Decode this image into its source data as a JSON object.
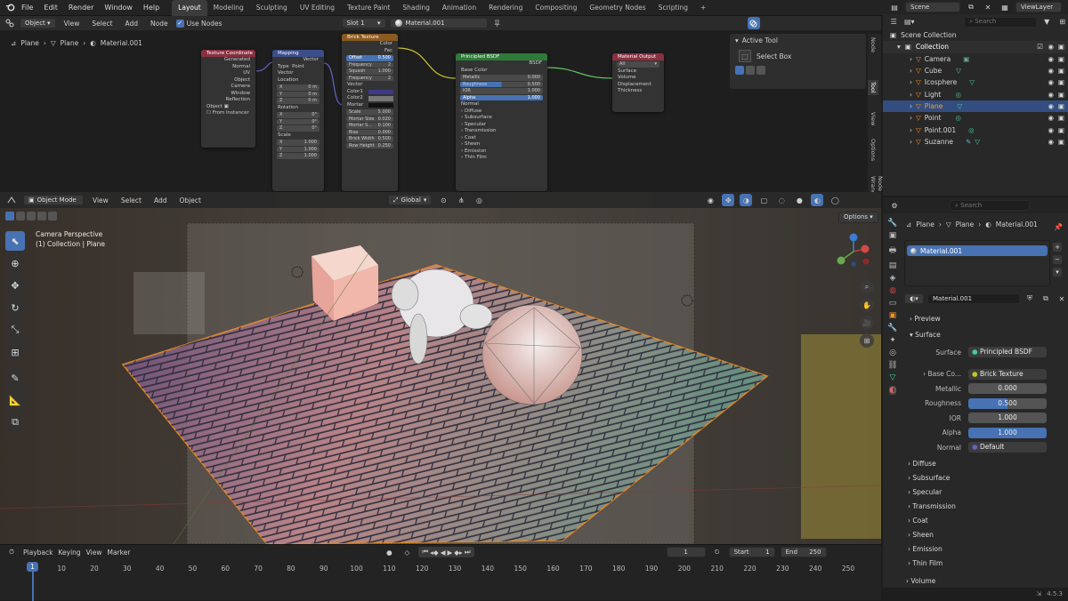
{
  "topbar": {
    "menus": [
      "File",
      "Edit",
      "Render",
      "Window",
      "Help"
    ],
    "workspaces": [
      "Layout",
      "Modeling",
      "Sculpting",
      "UV Editing",
      "Texture Paint",
      "Shading",
      "Animation",
      "Rendering",
      "Compositing",
      "Geometry Nodes",
      "Scripting"
    ],
    "active_workspace": "Layout",
    "scene": "Scene",
    "view_layer": "ViewLayer"
  },
  "node_editor": {
    "mode": "Object",
    "menus": [
      "View",
      "Select",
      "Add",
      "Node"
    ],
    "use_nodes_label": "Use Nodes",
    "slot": "Slot 1",
    "material": "Material.001",
    "breadcrumb": [
      "Plane",
      "Plane",
      "Material.001"
    ],
    "side_tabs": [
      "Node",
      "Tool",
      "View",
      "Options",
      "Node Wrangler"
    ],
    "active_tool_title": "Active Tool",
    "active_tool_item": "Select Box",
    "nodes": {
      "texcoord": {
        "title": "Texture Coordinate",
        "outputs": [
          "Generated",
          "Normal",
          "UV",
          "Object",
          "Camera",
          "Window",
          "Reflection"
        ],
        "object_label": "Object",
        "from_instancer": "From Instancer"
      },
      "mapping": {
        "title": "Mapping",
        "out": "Vector",
        "type_label": "Type",
        "type_val": "Point",
        "rows": [
          "Vector",
          "Location",
          "0 m",
          "0 m",
          "0 m",
          "Rotation",
          "0°",
          "0°",
          "0°",
          "Scale",
          "1.000",
          "1.000",
          "1.000"
        ],
        "labels": [
          "X",
          "Y",
          "Z",
          "X",
          "Y",
          "Z",
          "X",
          "Y",
          "Z"
        ]
      },
      "brick": {
        "title": "Brick Texture",
        "outputs": [
          "Color",
          "Fac"
        ],
        "offset_label": "Offset",
        "offset_val": "0.500",
        "frequency_label": "Frequency",
        "frequency_val": "2",
        "squash_label": "Squash",
        "squash_val": "1.000",
        "frequency2_label": "Frequency",
        "frequency2_val": "2",
        "vector": "Vector",
        "color1": "Color1",
        "color2": "Color2",
        "mortar": "Mortar",
        "scale_label": "Scale",
        "scale_val": "5.000",
        "mortar_size_label": "Mortar Size",
        "mortar_size_val": "0.020",
        "mortar_smooth_label": "Mortar S...",
        "mortar_smooth_val": "0.100",
        "bias_label": "Bias",
        "bias_val": "0.000",
        "brick_width_label": "Brick Width",
        "brick_width_val": "0.500",
        "row_height_label": "Row Height",
        "row_height_val": "0.250"
      },
      "bsdf": {
        "title": "Principled BSDF",
        "out": "BSDF",
        "base_color": "Base Color",
        "metallic_label": "Metallic",
        "metallic_val": "0.000",
        "roughness_label": "Roughness",
        "roughness_val": "0.500",
        "ior_label": "IOR",
        "ior_val": "1.000",
        "alpha_label": "Alpha",
        "alpha_val": "1.000",
        "normal": "Normal",
        "sections": [
          "Diffuse",
          "Subsurface",
          "Specular",
          "Transmission",
          "Coat",
          "Sheen",
          "Emission",
          "Thin Film"
        ]
      },
      "output": {
        "title": "Material Output",
        "target": "All",
        "inputs": [
          "Surface",
          "Volume",
          "Displacement",
          "Thickness"
        ]
      }
    }
  },
  "viewport": {
    "mode": "Object Mode",
    "menus": [
      "View",
      "Select",
      "Add",
      "Object"
    ],
    "orientation": "Global",
    "options": "Options",
    "overlay_line1": "Camera Perspective",
    "overlay_line2": "(1) Collection | Plane"
  },
  "outliner": {
    "search_placeholder": "Search",
    "root": "Scene Collection",
    "collection": "Collection",
    "items": [
      "Camera",
      "Cube",
      "Icosphere",
      "Light",
      "Plane",
      "Point",
      "Point.001",
      "Suzanne"
    ],
    "selected": "Plane"
  },
  "properties": {
    "search_placeholder": "Search",
    "breadcrumb": [
      "Plane",
      "Plane",
      "Material.001"
    ],
    "slot_item": "Material.001",
    "material_name": "Material.001",
    "preview": "Preview",
    "surface_section": "Surface",
    "surface_label": "Surface",
    "surface_val": "Principled BSDF",
    "base_color_label": "Base Co...",
    "base_color_val": "Brick Texture",
    "metallic_label": "Metallic",
    "metallic_val": "0.000",
    "roughness_label": "Roughness",
    "roughness_val": "0.500",
    "ior_label": "IOR",
    "ior_val": "1.000",
    "alpha_label": "Alpha",
    "alpha_val": "1.000",
    "normal_label": "Normal",
    "normal_val": "Default",
    "subsections": [
      "Diffuse",
      "Subsurface",
      "Specular",
      "Transmission",
      "Coat",
      "Sheen",
      "Emission",
      "Thin Film",
      "Volume"
    ]
  },
  "timeline": {
    "menus": [
      "Playback",
      "Keying",
      "View",
      "Marker"
    ],
    "current_frame": "1",
    "start_label": "Start",
    "start_val": "1",
    "end_label": "End",
    "end_val": "250",
    "ticks": [
      "1",
      "10",
      "20",
      "30",
      "40",
      "50",
      "60",
      "70",
      "80",
      "90",
      "100",
      "110",
      "120",
      "130",
      "140",
      "150",
      "160",
      "170",
      "180",
      "190",
      "200",
      "210",
      "220",
      "230",
      "240",
      "250"
    ]
  },
  "statusbar": {
    "version": "4.5.3"
  },
  "colors": {
    "accent": "#4772b3",
    "selected_row": "#334d80",
    "wire_yellow": "#c7c729",
    "wire_purple": "#6363c7",
    "wire_green": "#63c763",
    "selection_outline": "#f0902a"
  }
}
